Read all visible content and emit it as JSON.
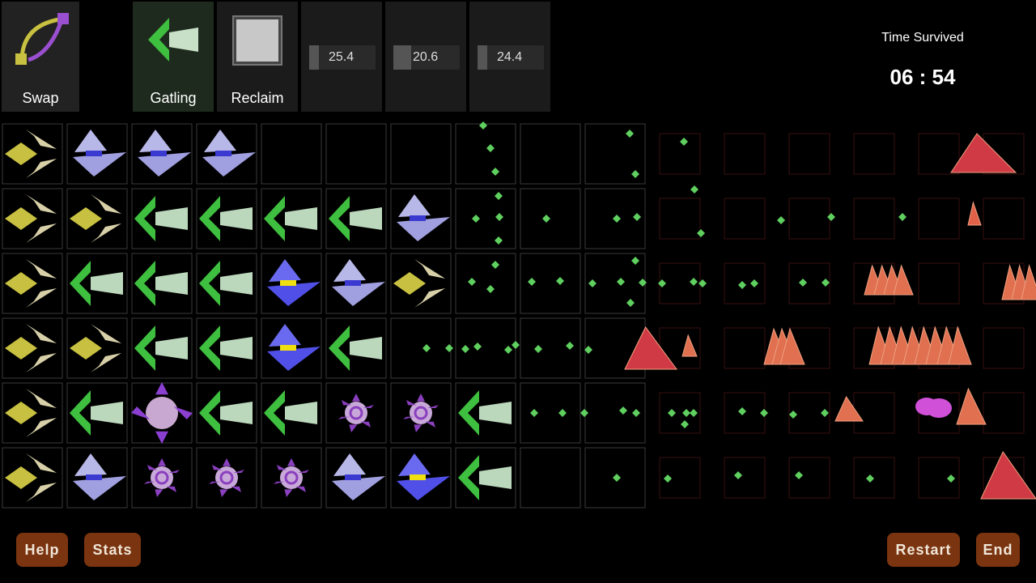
{
  "toolbar": {
    "swap_label": "Swap",
    "gatling_label": "Gatling",
    "reclaim_label": "Reclaim",
    "temperatures": [
      "25.4",
      "20.6",
      "24.4"
    ]
  },
  "timer": {
    "label": "Time Survived",
    "value": "06 : 54"
  },
  "buttons": {
    "help": "Help",
    "stats": "Stats",
    "restart": "Restart",
    "end": "End"
  },
  "grid": {
    "tower_rows": [
      [
        "swap",
        "laser",
        "laser",
        "laser",
        "",
        "",
        "",
        "",
        "",
        ""
      ],
      [
        "swap",
        "swap",
        "gatling",
        "gatling",
        "gatling",
        "gatling",
        "laser",
        "",
        "",
        ""
      ],
      [
        "swap",
        "gatling",
        "gatling",
        "gatling",
        "laser-hot",
        "laser",
        "swap",
        "",
        "",
        ""
      ],
      [
        "swap",
        "swap",
        "gatling",
        "gatling",
        "laser-hot",
        "gatling",
        "",
        "",
        "",
        ""
      ],
      [
        "swap",
        "gatling",
        "orb",
        "gatling",
        "gatling",
        "mine",
        "mine",
        "gatling",
        "",
        ""
      ],
      [
        "swap",
        "laser",
        "mine",
        "mine",
        "mine",
        "laser",
        "laser-hot",
        "gatling",
        "",
        ""
      ]
    ]
  },
  "colors": {
    "gatling": "#3fbf3f",
    "swap": "#c8c040",
    "laser": "#a0a0e0",
    "mine": "#8a3fbf",
    "enemy": "#e0504a",
    "button": "#7a3410"
  }
}
